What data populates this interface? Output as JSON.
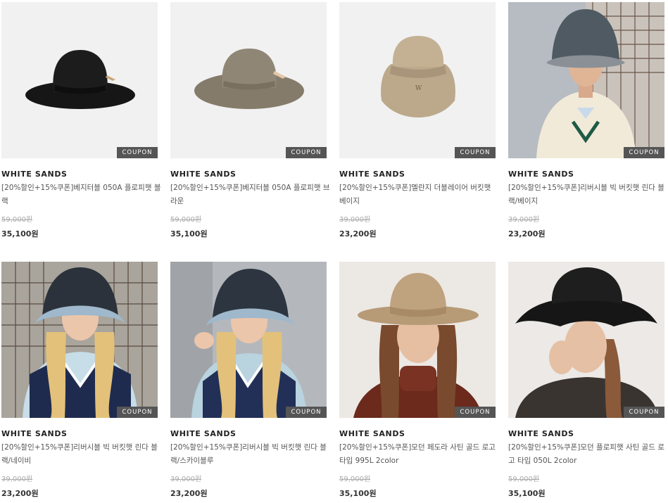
{
  "coupon_label": "COUPON",
  "products": [
    {
      "brand": "WHITE SANDS",
      "name": "[20%할인+15%쿠폰]베지터블 050A 플로피햇 블랙",
      "original_price": "59,000원",
      "sale_price": "35,100원",
      "image": "black-floppy-hat"
    },
    {
      "brand": "WHITE SANDS",
      "name": "[20%할인+15%쿠폰]베지터블 050A 플로피햇 브라운",
      "original_price": "59,000원",
      "sale_price": "35,100원",
      "image": "brown-floppy-hat"
    },
    {
      "brand": "WHITE SANDS",
      "name": "[20%할인+15%쿠폰]멜란지 더블레이어 버킷햇 베이지",
      "original_price": "39,000원",
      "sale_price": "23,200원",
      "image": "beige-bucket-hat"
    },
    {
      "brand": "WHITE SANDS",
      "name": "[20%할인+15%쿠폰]리버시블 빅 버킷햇 린다 블랙/베이지",
      "original_price": "39,000원",
      "sale_price": "23,200원",
      "image": "model-bucket-hat-black"
    },
    {
      "brand": "WHITE SANDS",
      "name": "[20%할인+15%쿠폰]리버시블 빅 버킷햇 린다 블랙/네이비",
      "original_price": "39,000원",
      "sale_price": "23,200원",
      "image": "model-bucket-hat-navy"
    },
    {
      "brand": "WHITE SANDS",
      "name": "[20%할인+15%쿠폰]리버시블 빅 버킷햇 린다 블랙/스카이블루",
      "original_price": "39,000원",
      "sale_price": "23,200원",
      "image": "model-bucket-hat-skyblue"
    },
    {
      "brand": "WHITE SANDS",
      "name": "[20%할인+15%쿠폰]모던 페도라 사틴 골드 로고 타입 995L 2color",
      "original_price": "59,000원",
      "sale_price": "35,100원",
      "image": "model-fedora"
    },
    {
      "brand": "WHITE SANDS",
      "name": "[20%할인+15%쿠폰]모던 플로피햇 사틴 골드 로고 타입 050L 2color",
      "original_price": "59,000원",
      "sale_price": "35,100원",
      "image": "model-floppy-hat-black"
    }
  ]
}
